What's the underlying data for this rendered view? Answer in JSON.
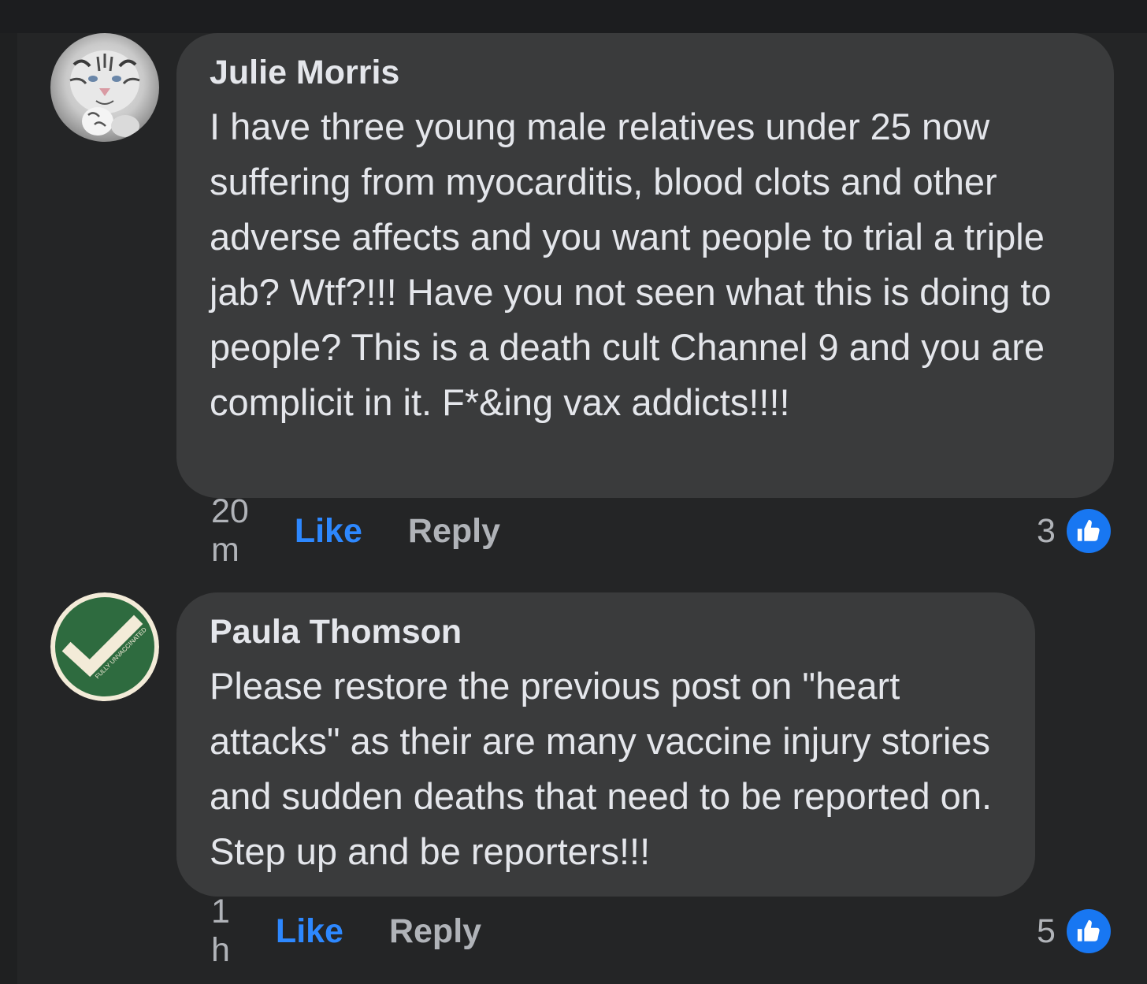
{
  "colors": {
    "background": "#242526",
    "bubble": "#3a3b3c",
    "text": "#e4e6eb",
    "meta": "#b0b3b8",
    "like_blue": "#2d88ff",
    "reaction_blue": "#1877f2"
  },
  "comments": [
    {
      "author": "Julie Morris",
      "avatar_icon": "white-tiger-photo-icon",
      "text": "I have three young male relatives under 25 now suffering from myocarditis, blood clots and other adverse affects and you want people to trial a triple jab? Wtf?!!! Have you not seen what this is doing to people? This is a death cult Channel 9 and you are complicit in it. F*&ing vax addicts!!!!",
      "time": "20 m",
      "like_label": "Like",
      "reply_label": "Reply",
      "reaction_count": "3",
      "reaction_icon": "thumbs-up-icon"
    },
    {
      "author": "Paula Thomson",
      "avatar_icon": "checkmark-badge-icon",
      "avatar_badge_text": "FULLY UNVACCINATED",
      "text": "Please restore the previous post on \"heart attacks\" as their are many vaccine injury stories and sudden deaths that need to be reported on.  Step up and be reporters!!!",
      "time": "1 h",
      "like_label": "Like",
      "reply_label": "Reply",
      "reaction_count": "5",
      "reaction_icon": "thumbs-up-icon"
    }
  ]
}
